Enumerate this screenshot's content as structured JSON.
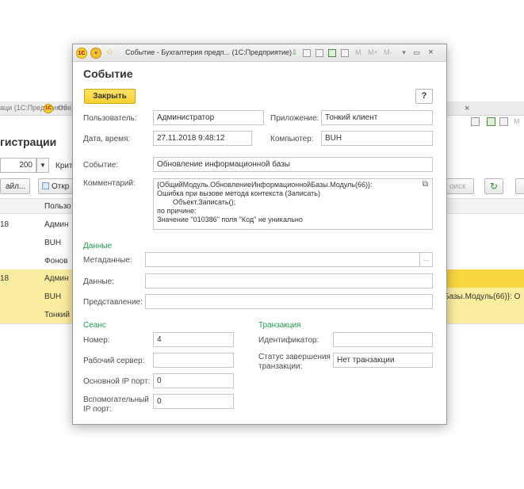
{
  "background_window": {
    "tab1_label": "Об...",
    "tab_truncated_label": "аци (1С:Предприятие)",
    "heading": "гистрации",
    "count_value": "200",
    "filter_label": "Крит",
    "buttons": {
      "file_label": "айл...",
      "open_label": "Откр",
      "search_label": "оиск"
    },
    "column_user_header": "Пользо",
    "rows": [
      {
        "date": "18",
        "user": "Админ"
      },
      {
        "date": "",
        "user": "BUH"
      },
      {
        "date": "",
        "user": "Фонов"
      },
      {
        "date": "18",
        "user": "Админ"
      },
      {
        "date": "",
        "user": "BUH"
      },
      {
        "date": "",
        "user": "Тонкий"
      }
    ],
    "overflow_text": "Базы.Модуль(66)}: О"
  },
  "dialog": {
    "title": "Событие - Бухгалтерия предп... (1С:Предприятие)",
    "heading": "Событие",
    "close_button": "Закрыть",
    "help_button": "?",
    "user": {
      "label": "Пользователь:",
      "value": "Администратор"
    },
    "application": {
      "label": "Приложение:",
      "value": "Тонкий клиент"
    },
    "datetime": {
      "label": "Дата, время:",
      "value": "27.11.2018  9:48:12"
    },
    "computer": {
      "label": "Компьютер:",
      "value": "BUH"
    },
    "event": {
      "label": "Событие:",
      "value": "Обновление информационной базы"
    },
    "comment": {
      "label": "Комментарий:",
      "lines": [
        "{ОбщийМодуль.ОбновлениеИнформационнойБазы.Модуль(66)}:",
        "Ошибка при вызове метода контекста (Записать)",
        "        Объект.Записать();",
        "по причине:",
        "Значение \"010386\" поля \"Код\" не уникально"
      ]
    },
    "data_section": {
      "title": "Данные",
      "metadata_label": "Метаданные:",
      "data_label": "Данные:",
      "representation_label": "Представление:",
      "metadata_value": "",
      "data_value": "",
      "representation_value": ""
    },
    "session_section": {
      "title": "Сеанс",
      "number": {
        "label": "Номер:",
        "value": "4"
      },
      "server": {
        "label": "Рабочий сервер:",
        "value": ""
      },
      "main_port": {
        "label": "Основной IP порт:",
        "value": "0"
      },
      "aux_port": {
        "label_line1": "Вспомогательный",
        "label_line2": "IP порт:",
        "value": "0"
      }
    },
    "transaction_section": {
      "title": "Транзакция",
      "id": {
        "label": "Идентификатор:",
        "value": ""
      },
      "status": {
        "label_line1": "Статус завершения",
        "label_line2": "транзакции:",
        "value": "Нет транзакции"
      }
    }
  },
  "colors": {
    "accent_yellow": "#f7d12e",
    "section_green": "#25994c",
    "selected_row": "#fbeda0"
  }
}
